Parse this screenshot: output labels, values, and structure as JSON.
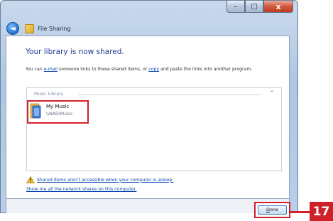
{
  "window": {
    "title": "File Sharing",
    "caption_buttons": {
      "minimize": "–",
      "maximize": "□",
      "close": "x"
    },
    "back_glyph": "◄"
  },
  "content": {
    "heading": "Your library is now shared.",
    "intro": {
      "before": "You can ",
      "email_link": "e-mail",
      "middle": " someone links to these shared items, or ",
      "copy_link": "copy",
      "after": " and paste the links into another program."
    },
    "library_group": {
      "label": "Music Library",
      "chevron": "^",
      "items": [
        {
          "name": "My Music",
          "path": "\\\\NAD\\Music",
          "icon": "music-folder-icon"
        }
      ]
    },
    "warning_text": "Shared items aren't accessible when your computer is asleep.",
    "show_all_link": "Show me all the network shares on this computer."
  },
  "footer": {
    "done_label": {
      "mnemonic": "D",
      "rest": "one"
    }
  },
  "annotation": {
    "step_number": "17",
    "color": "#d0202a"
  },
  "colors": {
    "heading": "#1e3a8c",
    "link": "#0645ad",
    "highlight": "#d0202a"
  }
}
